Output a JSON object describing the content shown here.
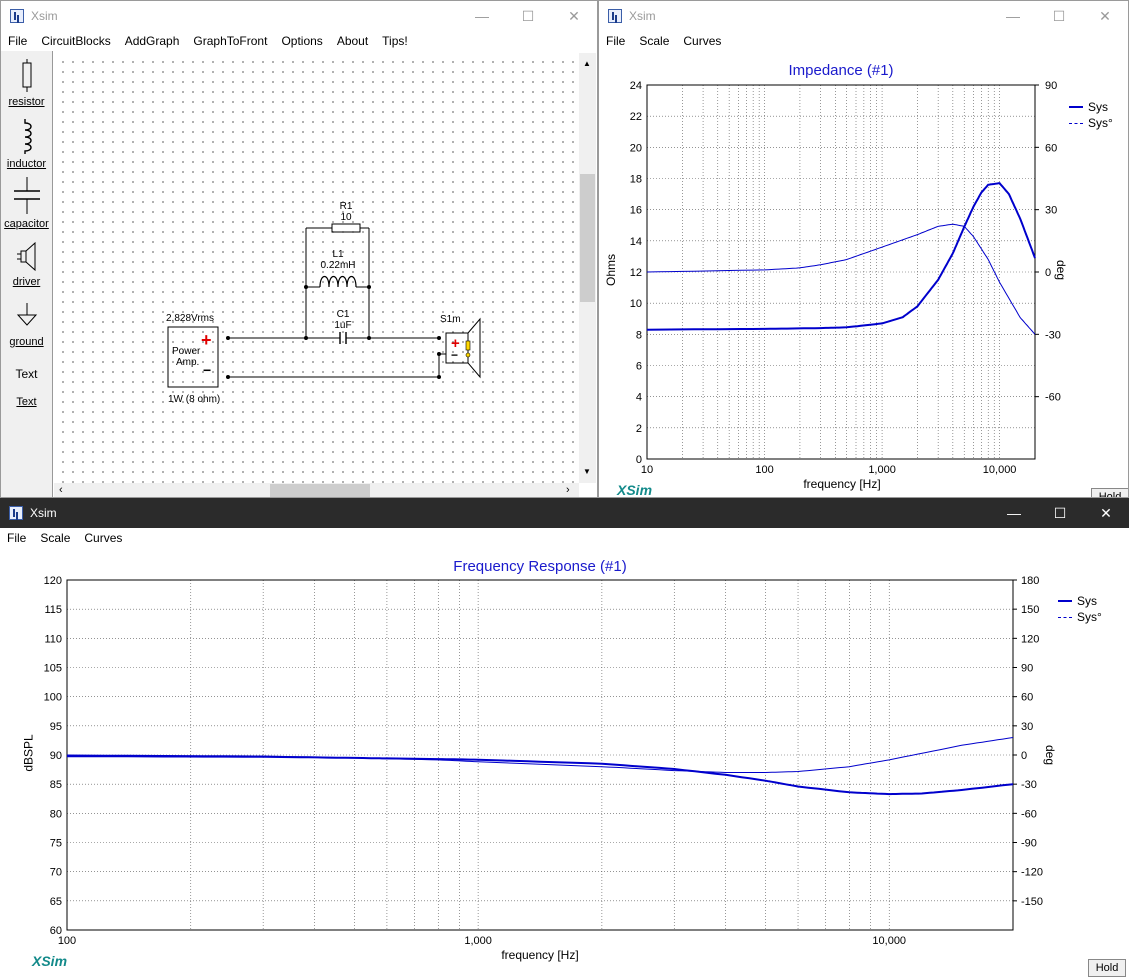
{
  "circuit_window": {
    "title": "Xsim",
    "menu": [
      "File",
      "CircuitBlocks",
      "AddGraph",
      "GraphToFront",
      "Options",
      "About",
      "Tips!"
    ],
    "palette": [
      {
        "label": "resistor",
        "icon": "resistor-icon"
      },
      {
        "label": "inductor",
        "icon": "inductor-icon"
      },
      {
        "label": "capacitor",
        "icon": "capacitor-icon"
      },
      {
        "label": "driver",
        "icon": "driver-icon"
      },
      {
        "label": "ground",
        "icon": "ground-icon"
      },
      {
        "label": "Text",
        "icon": "text-icon",
        "glyph": "Text"
      }
    ],
    "components": {
      "r1_name": "R1",
      "r1_value": "10",
      "l1_name": "L1",
      "l1_value": "0.22mH",
      "c1_name": "C1",
      "c1_value": "1uF",
      "amp_voltage": "2.828Vrms",
      "amp_line1": "Power",
      "amp_line2": "Amp.",
      "amp_power": "1W (8 ohm)",
      "plus": "+",
      "minus": "−",
      "driver_name": "S1m"
    }
  },
  "impedance_window": {
    "title": "Xsim",
    "menu": [
      "File",
      "Scale",
      "Curves"
    ],
    "brand": "XSim",
    "hold": "Hold",
    "chart_data": {
      "type": "line",
      "title": "Impedance (#1)",
      "xlabel": "frequency [Hz]",
      "ylabel": "Ohms",
      "y2label": "deg",
      "xscale": "log",
      "xlim": [
        10,
        20000
      ],
      "ylim": [
        0,
        24
      ],
      "y2lim": [
        -90,
        90
      ],
      "x_ticks": [
        "10",
        "100",
        "1,000",
        "10,000"
      ],
      "y_ticks": [
        "0",
        "2",
        "4",
        "6",
        "8",
        "10",
        "12",
        "14",
        "16",
        "18",
        "20",
        "22",
        "24"
      ],
      "y2_ticks": [
        "90",
        "60",
        "30",
        "0",
        "-30",
        "-60"
      ],
      "legend": [
        "Sys",
        "Sys°"
      ],
      "legend_position": "top-right",
      "grid": true,
      "series": [
        {
          "name": "Sys",
          "axis": "left",
          "color": "#0000cc",
          "style": "thick",
          "x": [
            10,
            100,
            300,
            500,
            1000,
            1500,
            2000,
            3000,
            4000,
            5000,
            6000,
            7000,
            8000,
            10000,
            12000,
            15000,
            20000
          ],
          "y": [
            8.3,
            8.35,
            8.4,
            8.45,
            8.7,
            9.1,
            9.8,
            11.5,
            13.2,
            14.9,
            16.2,
            17.1,
            17.6,
            17.7,
            17.0,
            15.4,
            12.9
          ]
        },
        {
          "name": "Sys°",
          "axis": "right",
          "color": "#0000cc",
          "style": "thin",
          "x": [
            10,
            100,
            200,
            300,
            500,
            1000,
            2000,
            3000,
            4000,
            5000,
            6000,
            8000,
            10000,
            15000,
            20000
          ],
          "y": [
            0,
            1,
            2,
            3.5,
            6,
            12,
            18,
            22,
            23,
            22,
            17,
            6,
            -5,
            -22,
            -30
          ]
        }
      ]
    }
  },
  "frequency_window": {
    "title": "Xsim",
    "menu": [
      "File",
      "Scale",
      "Curves"
    ],
    "brand": "XSim",
    "hold": "Hold",
    "chart_data": {
      "type": "line",
      "title": "Frequency Response (#1)",
      "xlabel": "frequency [Hz]",
      "ylabel": "dBSPL",
      "y2label": "deg",
      "xscale": "log",
      "xlim": [
        100,
        20000
      ],
      "ylim": [
        60,
        120
      ],
      "y2lim": [
        -180,
        180
      ],
      "x_ticks": [
        "100",
        "1,000",
        "10,000"
      ],
      "y_ticks": [
        "60",
        "65",
        "70",
        "75",
        "80",
        "85",
        "90",
        "95",
        "100",
        "105",
        "110",
        "115",
        "120"
      ],
      "y2_ticks": [
        "180",
        "150",
        "120",
        "90",
        "60",
        "30",
        "0",
        "-30",
        "-60",
        "-90",
        "-120",
        "-150"
      ],
      "legend": [
        "Sys",
        "Sys°"
      ],
      "legend_position": "top-right",
      "grid": true,
      "series": [
        {
          "name": "Sys",
          "axis": "left",
          "color": "#0000cc",
          "style": "thick",
          "x": [
            100,
            300,
            500,
            800,
            1000,
            2000,
            3000,
            4000,
            5000,
            6000,
            8000,
            10000,
            12000,
            15000,
            20000
          ],
          "y": [
            89.8,
            89.7,
            89.5,
            89.3,
            89.2,
            88.5,
            87.6,
            86.6,
            85.6,
            84.6,
            83.6,
            83.3,
            83.4,
            84.0,
            85.0
          ]
        },
        {
          "name": "Sys°",
          "axis": "right",
          "color": "#0000cc",
          "style": "thin",
          "x": [
            100,
            300,
            500,
            800,
            1000,
            2000,
            3000,
            4000,
            5000,
            6000,
            8000,
            10000,
            15000,
            20000
          ],
          "y": [
            0,
            -1,
            -3,
            -5,
            -7,
            -12,
            -16,
            -18,
            -18,
            -17,
            -12,
            -5,
            10,
            18
          ]
        }
      ]
    }
  }
}
